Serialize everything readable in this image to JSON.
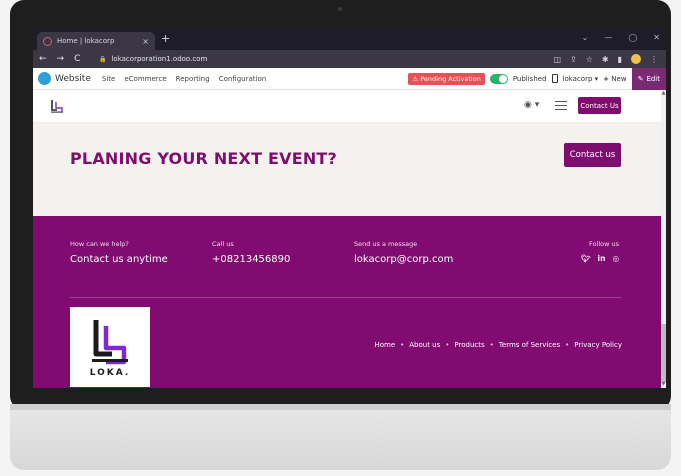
{
  "browser": {
    "tab_title": "Home | lokacorp",
    "tab_close": "×",
    "new_tab": "+",
    "window_controls": [
      "⌄",
      "—",
      "◯",
      "✕"
    ],
    "url": "lokacorporation1.odoo.com",
    "nav_back": "←",
    "nav_forward": "→",
    "nav_reload": "C"
  },
  "odoo": {
    "app_name": "Website",
    "menu": [
      "Site",
      "eCommerce",
      "Reporting",
      "Configuration"
    ],
    "pending": "Pending Activation",
    "published": "Published",
    "company": "lokacorp",
    "new_label": "New",
    "edit_label": "Edit"
  },
  "header": {
    "contact_label": "Contact Us"
  },
  "cta": {
    "title": "PLANING YOUR NEXT EVENT?",
    "button": "Contact us"
  },
  "footer": {
    "help_label": "How can we help?",
    "help_value": "Contact us anytime",
    "call_label": "Call us",
    "call_value": "+08213456890",
    "message_label": "Send us a message",
    "message_value": "lokacorp@corp.com",
    "follow_label": "Follow us",
    "social": [
      "twitter-icon",
      "linkedin-icon",
      "instagram-icon"
    ],
    "logo_text": "LOKA.",
    "links": [
      "Home",
      "About us",
      "Products",
      "Terms of Services",
      "Privacy Policy"
    ]
  },
  "colors": {
    "brand": "#820b72",
    "cta_bg": "#f4f1ef",
    "pending": "#e25256",
    "published": "#2fb06b"
  }
}
